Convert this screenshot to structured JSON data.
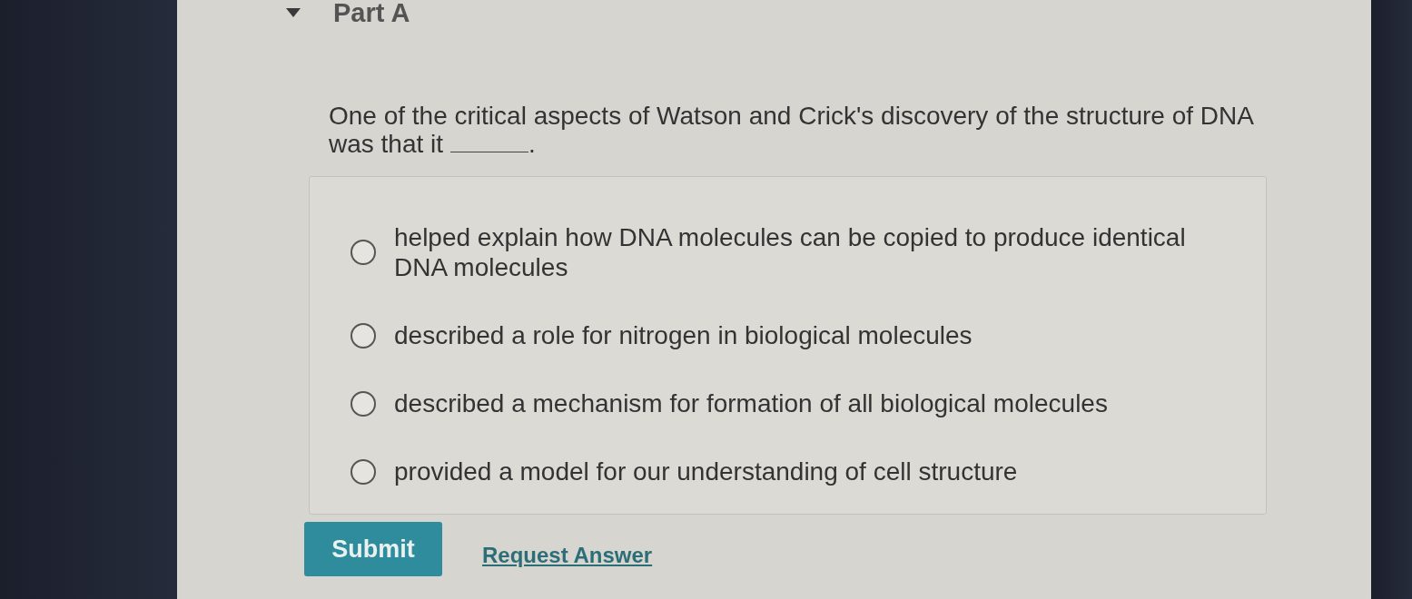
{
  "part": {
    "title": "Part A",
    "expanded": true
  },
  "question": {
    "lines": [
      "One of the critical aspects of Watson and Crick's discovery of the structure of DNA",
      "was that it"
    ],
    "after_blank": "."
  },
  "options": [
    {
      "label": "helped explain how DNA molecules can be copied to produce identical DNA molecules",
      "selected": false
    },
    {
      "label": "described a role for nitrogen in biological molecules",
      "selected": false
    },
    {
      "label": "described a mechanism for formation of all biological molecules",
      "selected": false
    },
    {
      "label": "provided a model for our understanding of cell structure",
      "selected": false
    }
  ],
  "actions": {
    "submit": "Submit",
    "request_answer": "Request Answer"
  }
}
